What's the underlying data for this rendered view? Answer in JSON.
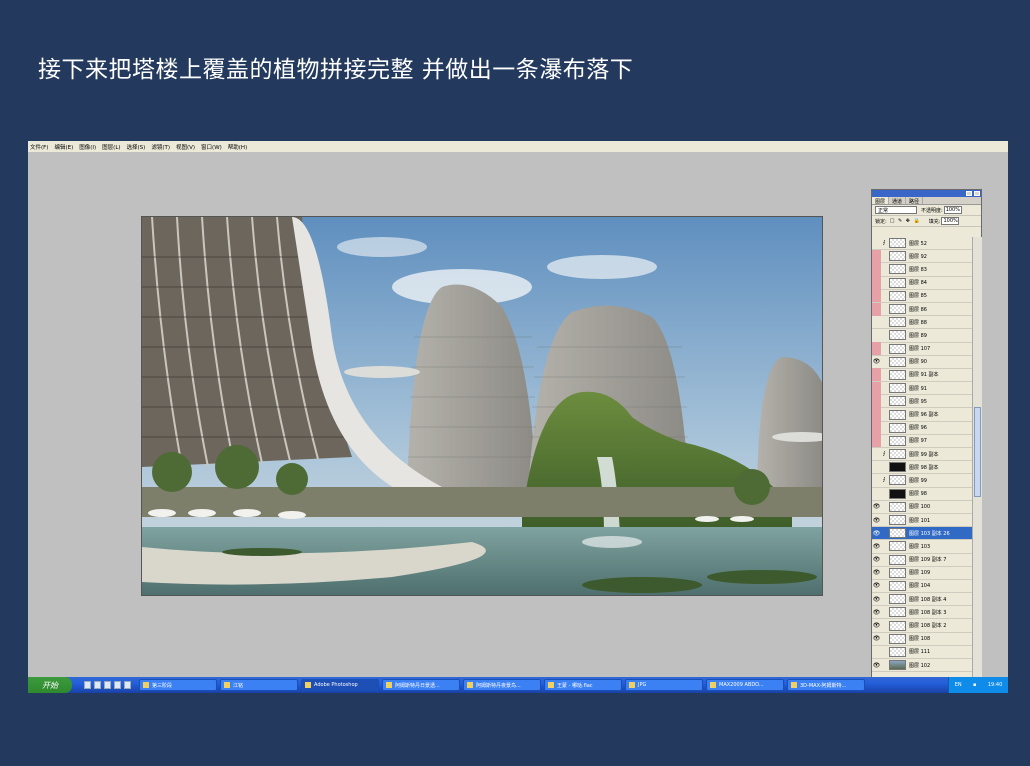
{
  "slide": {
    "title": "接下来把塔楼上覆盖的植物拼接完整 并做出一条瀑布落下"
  },
  "app": {
    "menu": [
      "文件(F)",
      "编辑(E)",
      "图像(I)",
      "图层(L)",
      "选择(S)",
      "滤镜(T)",
      "视图(V)",
      "窗口(W)",
      "帮助(H)"
    ]
  },
  "layers_panel": {
    "tabs": [
      "图层",
      "通道",
      "路径"
    ],
    "blend_mode": "正常",
    "opacity_label": "不透明度:",
    "opacity_value": "100%",
    "lock_label": "锁定:",
    "fill_label": "填充:",
    "fill_value": "100%",
    "layers": [
      {
        "name": "图层 52",
        "thumb": "checker",
        "eye": "plain",
        "chain": true
      },
      {
        "name": "图层 92",
        "thumb": "checker",
        "eye": "pink",
        "chain": false
      },
      {
        "name": "图层 83",
        "thumb": "checker",
        "eye": "pink",
        "chain": false
      },
      {
        "name": "图层 84",
        "thumb": "checker",
        "eye": "pink",
        "chain": false
      },
      {
        "name": "图层 85",
        "thumb": "checker",
        "eye": "pink",
        "chain": false
      },
      {
        "name": "图层 86",
        "thumb": "checker",
        "eye": "pink",
        "chain": false
      },
      {
        "name": "图层 88",
        "thumb": "checker",
        "eye": "plain",
        "chain": false
      },
      {
        "name": "图层 89",
        "thumb": "checker",
        "eye": "plain",
        "chain": false
      },
      {
        "name": "图层 107",
        "thumb": "checker",
        "eye": "pink",
        "chain": false
      },
      {
        "name": "图层 90",
        "thumb": "checker",
        "eye": "visible",
        "chain": false
      },
      {
        "name": "图层 91 副本",
        "thumb": "checker",
        "eye": "pink",
        "chain": false
      },
      {
        "name": "图层 91",
        "thumb": "checker",
        "eye": "pink",
        "chain": false
      },
      {
        "name": "图层 95",
        "thumb": "checker",
        "eye": "pink",
        "chain": false
      },
      {
        "name": "图层 96 副本",
        "thumb": "checker",
        "eye": "pink",
        "chain": false
      },
      {
        "name": "图层 96",
        "thumb": "checker",
        "eye": "pink",
        "chain": false
      },
      {
        "name": "图层 97",
        "thumb": "checker",
        "eye": "pink",
        "chain": false
      },
      {
        "name": "图层 99 副本",
        "thumb": "checker",
        "eye": "plain",
        "chain": true
      },
      {
        "name": "图层 98 副本",
        "thumb": "dark",
        "eye": "plain",
        "chain": false
      },
      {
        "name": "图层 99",
        "thumb": "checker",
        "eye": "plain",
        "chain": true
      },
      {
        "name": "图层 98",
        "thumb": "dark",
        "eye": "plain",
        "chain": false
      },
      {
        "name": "图层 100",
        "thumb": "checker",
        "eye": "visible",
        "chain": false
      },
      {
        "name": "图层 101",
        "thumb": "checker",
        "eye": "visible",
        "chain": false
      },
      {
        "name": "图层 103 副本 26",
        "thumb": "checker",
        "eye": "visible",
        "chain": false,
        "selected": true
      },
      {
        "name": "图层 103",
        "thumb": "checker",
        "eye": "visible",
        "chain": false
      },
      {
        "name": "图层 109 副本 7",
        "thumb": "checker",
        "eye": "visible",
        "chain": false
      },
      {
        "name": "图层 109",
        "thumb": "checker",
        "eye": "visible",
        "chain": false
      },
      {
        "name": "图层 104",
        "thumb": "checker",
        "eye": "visible",
        "chain": false
      },
      {
        "name": "图层 108 副本 4",
        "thumb": "checker",
        "eye": "visible",
        "chain": false
      },
      {
        "name": "图层 108 副本 3",
        "thumb": "checker",
        "eye": "visible",
        "chain": false
      },
      {
        "name": "图层 108 副本 2",
        "thumb": "checker",
        "eye": "visible",
        "chain": false
      },
      {
        "name": "图层 108",
        "thumb": "checker",
        "eye": "visible",
        "chain": false
      },
      {
        "name": "图层 111",
        "thumb": "checker",
        "eye": "plain",
        "chain": false
      },
      {
        "name": "图层 102",
        "thumb": "scene",
        "eye": "visible",
        "chain": false
      }
    ]
  },
  "taskbar": {
    "start_label": "开始",
    "tasks": [
      {
        "label": "第三阶段",
        "active": false
      },
      {
        "label": "江铭",
        "active": false
      },
      {
        "label": "Adobe Photoshop",
        "active": true
      },
      {
        "label": "阿姆斯特丹日景透...",
        "active": false
      },
      {
        "label": "阿姆斯特丹夜景鸟...",
        "active": false
      },
      {
        "label": "王蒙 - 哪哒.flac",
        "active": false
      },
      {
        "label": "JPG",
        "active": false
      },
      {
        "label": "MAX2009 ABDO...",
        "active": false
      },
      {
        "label": "3D-MAX-阿姆斯特...",
        "active": false
      }
    ],
    "tray_lang": "EN",
    "clock": "19:40"
  },
  "colors": {
    "slide_bg": "#233a5e",
    "selection": "#316ac5",
    "pink_eye": "#e8a0a8"
  }
}
